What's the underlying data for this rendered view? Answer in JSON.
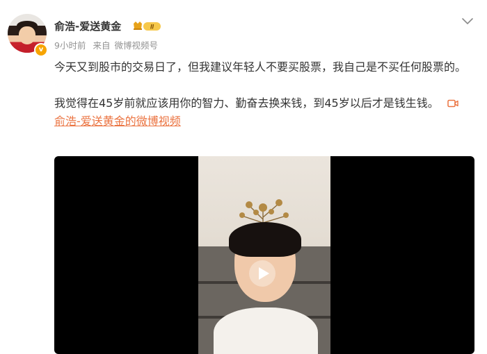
{
  "post": {
    "author": {
      "name": "俞浩-爱送黄金",
      "level_badge_text": "II",
      "verified_icon": "verified-v-icon"
    },
    "meta": {
      "time": "9小时前",
      "source_prefix": "来自",
      "source": "微博视频号"
    },
    "menu_icon": "chevron-down-icon",
    "text": {
      "paragraph1": "今天又到股市的交易日了，但我建议年轻人不要买股票，我自己是不买任何股票的。",
      "paragraph2": "我觉得在45岁前就应该用你的智力、勤奋去换来钱，到45岁以后才是钱生钱。"
    },
    "video_link": {
      "icon": "video-camera-icon",
      "label": "俞浩-爱送黄金的微博视频"
    },
    "video": {
      "play_icon": "play-icon"
    }
  },
  "colors": {
    "link": "#eb7340",
    "text": "#333333",
    "meta": "#939393",
    "badge": "#f7a400"
  }
}
